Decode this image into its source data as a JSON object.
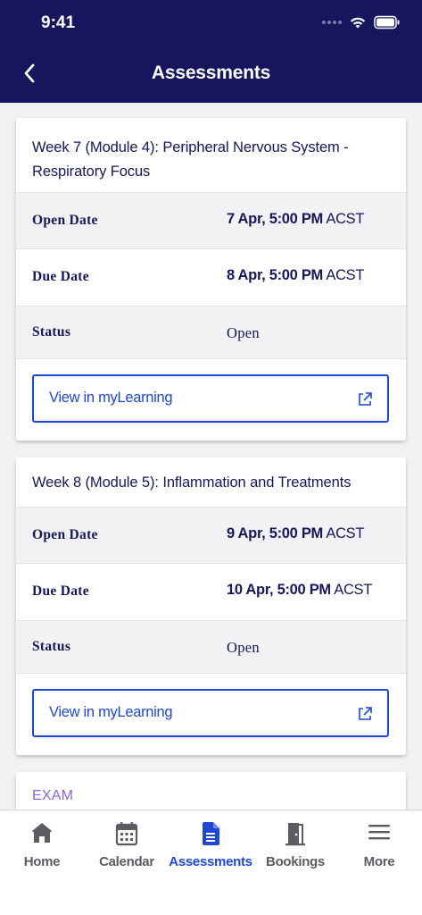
{
  "status_bar": {
    "time": "9:41"
  },
  "nav": {
    "title": "Assessments"
  },
  "cards": [
    {
      "title": "Week 7 (Module 4): Peripheral Nervous System - Respiratory Focus",
      "open_label": "Open Date",
      "open_value": "7 Apr, 5:00 PM",
      "open_tz": "ACST",
      "due_label": "Due Date",
      "due_value": "8 Apr, 5:00 PM",
      "due_tz": "ACST",
      "status_label": "Status",
      "status_value": "Open",
      "link_label": "View in myLearning"
    },
    {
      "title": "Week 8 (Module 5): Inflammation and Treatments",
      "open_label": "Open Date",
      "open_value": "9 Apr, 5:00 PM",
      "open_tz": "ACST",
      "due_label": "Due Date",
      "due_value": "10 Apr, 5:00 PM",
      "due_tz": "ACST",
      "status_label": "Status",
      "status_value": "Open",
      "link_label": "View in myLearning"
    }
  ],
  "exam_card": {
    "label": "EXAM"
  },
  "tabs": [
    {
      "label": "Home",
      "icon": "home-icon"
    },
    {
      "label": "Calendar",
      "icon": "calendar-icon"
    },
    {
      "label": "Assessments",
      "icon": "document-icon",
      "active": true
    },
    {
      "label": "Bookings",
      "icon": "door-icon"
    },
    {
      "label": "More",
      "icon": "menu-icon"
    }
  ],
  "colors": {
    "header": "#16155e",
    "accent": "#1e47d6",
    "exam": "#8c63e6",
    "text": "#15175b"
  }
}
